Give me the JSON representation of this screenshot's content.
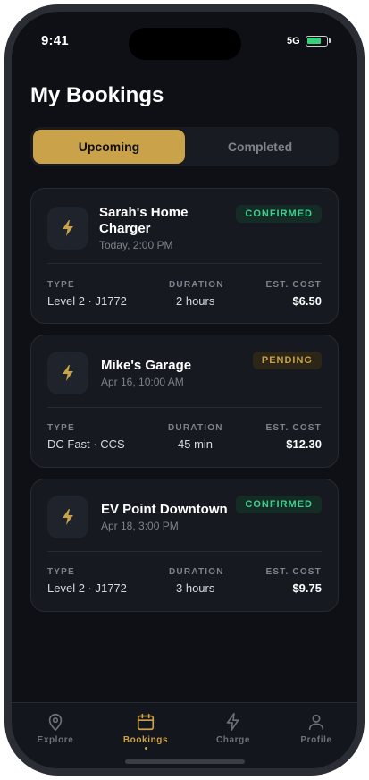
{
  "status": {
    "time": "9:41",
    "signal": "5G",
    "battery_level": 0.8
  },
  "title": "My Bookings",
  "segments": {
    "active": "Upcoming",
    "inactive": "Completed"
  },
  "labels": {
    "type": "TYPE",
    "duration": "DURATION",
    "cost": "EST. COST"
  },
  "bookings": [
    {
      "name": "Sarah's Home Charger",
      "time": "Today, 2:00 PM",
      "status": "CONFIRMED",
      "type": "Level 2 · J1772",
      "duration": "2 hours",
      "cost": "$6.50"
    },
    {
      "name": "Mike's Garage",
      "time": "Apr 16, 10:00 AM",
      "status": "PENDING",
      "type": "DC Fast · CCS",
      "duration": "45 min",
      "cost": "$12.30"
    },
    {
      "name": "EV Point Downtown",
      "time": "Apr 18, 3:00 PM",
      "status": "CONFIRMED",
      "type": "Level 2 · J1772",
      "duration": "3 hours",
      "cost": "$9.75"
    }
  ],
  "tabs": [
    {
      "label": "Explore",
      "icon": "map-pin-icon",
      "active": false
    },
    {
      "label": "Bookings",
      "icon": "calendar-icon",
      "active": true
    },
    {
      "label": "Charge",
      "icon": "lightning-icon",
      "active": false
    },
    {
      "label": "Profile",
      "icon": "user-icon",
      "active": false
    }
  ],
  "colors": {
    "accent": "#c9a24a",
    "confirmed": "#3ecf8e",
    "background": "#0e1015",
    "card": "#161920"
  }
}
